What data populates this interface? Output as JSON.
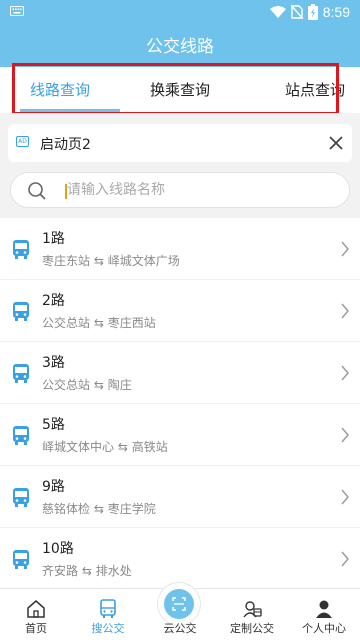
{
  "status_bar": {
    "time": "8:59"
  },
  "header": {
    "title": "公交线路"
  },
  "tabs": [
    {
      "label": "线路查询",
      "active": true
    },
    {
      "label": "换乘查询",
      "active": false
    },
    {
      "label": "站点查询",
      "active": false
    }
  ],
  "ad": {
    "badge": "AD",
    "title": "启动页2"
  },
  "search": {
    "placeholder": "请输入线路名称",
    "value": ""
  },
  "routes": [
    {
      "name": "1路",
      "from": "枣庄东站",
      "to": "峄城文体广场"
    },
    {
      "name": "2路",
      "from": "公交总站",
      "to": "枣庄西站"
    },
    {
      "name": "3路",
      "from": "公交总站",
      "to": "陶庄"
    },
    {
      "name": "5路",
      "from": "峄城文体中心",
      "to": "高铁站"
    },
    {
      "name": "9路",
      "from": "慈铭体检",
      "to": "枣庄学院"
    },
    {
      "name": "10路",
      "from": "齐安路",
      "to": "排水处"
    }
  ],
  "arrow_symbol": "⇆",
  "bottom_nav": [
    {
      "label": "首页",
      "active": false
    },
    {
      "label": "搜公交",
      "active": true
    },
    {
      "label": "云公交",
      "active": false
    },
    {
      "label": "定制公交",
      "active": false
    },
    {
      "label": "个人中心",
      "active": false
    }
  ],
  "colors": {
    "header": "#6ec2ec",
    "accent": "#3aa0e4",
    "highlight_box": "#e0161c"
  }
}
